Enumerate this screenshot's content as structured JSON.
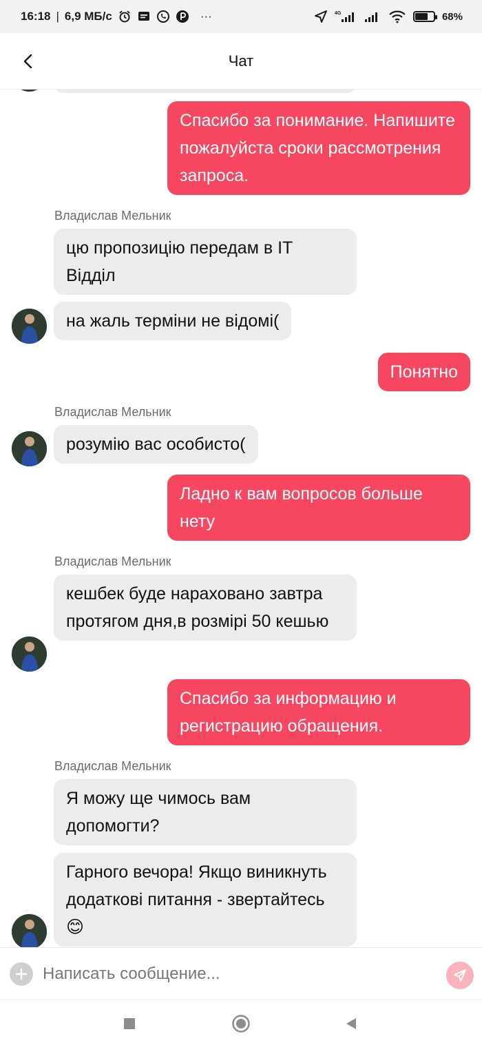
{
  "status_bar": {
    "time": "16:18",
    "separator": "|",
    "speed": "6,9 МБ/с",
    "dots": "···",
    "network": "4G",
    "battery": "68%",
    "battery_level": 0.68
  },
  "header": {
    "title": "Чат"
  },
  "messages": [
    {
      "text": "Спасибо за понимание. Напишите пожалуйста сроки рассмотрения запроса."
    },
    {
      "text": "цю пропозицію передам в IT Відділ"
    },
    {
      "text": "на жаль терміни не відомі("
    },
    {
      "text": "Понятно"
    },
    {
      "text": "розумію вас особисто("
    },
    {
      "text": "Ладно к вам вопросов больше нету"
    },
    {
      "text": "кешбек буде нараховано завтра протягом дня,в розмірі 50 кешью"
    },
    {
      "text": "Спасибо за информацию и регистрацию обращения."
    },
    {
      "text": "Я можу ще чимось вам допомогти?"
    },
    {
      "text": "Гарного вечора! Якщо виникнуть додаткові питання - звертайтесь 😊"
    }
  ],
  "agent": {
    "name": "Владислав Мельник"
  },
  "compose": {
    "placeholder": "Написать сообщение..."
  },
  "colors": {
    "outgoing_bubble": "#f74760",
    "incoming_bubble": "#ececec",
    "send_button": "#f9b3bd"
  }
}
